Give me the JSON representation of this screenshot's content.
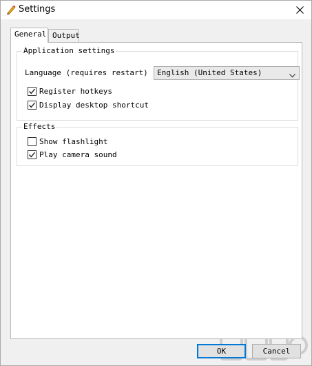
{
  "window": {
    "title": "Settings",
    "app_icon": "pencil-icon",
    "close_icon": "close-icon"
  },
  "tabs": [
    {
      "label": "General",
      "active": true
    },
    {
      "label": "Output",
      "active": false
    }
  ],
  "application_settings": {
    "title": "Application settings",
    "language_label": "Language (requires restart)",
    "language_value": "English (United States)",
    "register_hotkeys": {
      "label": "Register hotkeys",
      "checked": true
    },
    "desktop_shortcut": {
      "label": "Display desktop shortcut",
      "checked": true
    }
  },
  "effects": {
    "title": "Effects",
    "show_flashlight": {
      "label": "Show flashlight",
      "checked": false
    },
    "play_camera_sound": {
      "label": "Play camera sound",
      "checked": true
    }
  },
  "buttons": {
    "ok": "OK",
    "cancel": "Cancel"
  },
  "colors": {
    "focus_border": "#0078d7",
    "panel_background": "#ffffff",
    "dialog_background": "#f0f0f0"
  }
}
